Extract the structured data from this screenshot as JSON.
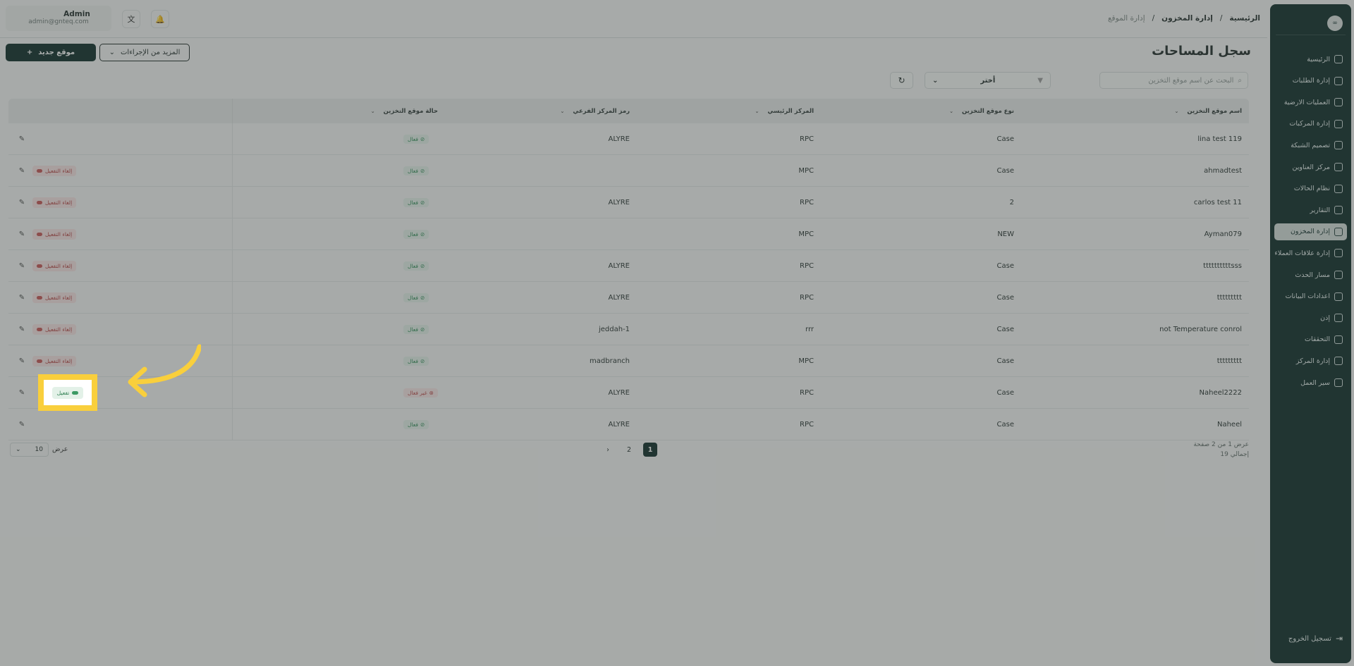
{
  "user": {
    "name": "Admin",
    "email": "admin@gnteq.com"
  },
  "breadcrumb": [
    "الرئيسية",
    "/",
    "إدارة المخزون",
    "/",
    "إدارة الموقع"
  ],
  "page_title": "سجل المساحات",
  "actions": {
    "new_location": "موقع جديد",
    "more_actions": "المزيد من الإجراءات"
  },
  "search": {
    "placeholder": "البحث عن اسم موقع التخزين"
  },
  "filter_select": {
    "value": "أختر"
  },
  "columns": [
    "اسم موقع التخزين",
    "نوع موقع التخزين",
    "المركز الرئيسي",
    "رمز المركز الفرعي",
    "حالة موقع التخزين"
  ],
  "rows": [
    {
      "name": "lina test 119",
      "type": "Case",
      "main": "RPC",
      "branch": "ALYRE",
      "status": "فعال"
    },
    {
      "name": "ahmadtest",
      "type": "Case",
      "main": "MPC",
      "branch": "",
      "status": "فعال"
    },
    {
      "name": "carlos test 11",
      "type": "2",
      "main": "RPC",
      "branch": "ALYRE",
      "status": "فعال"
    },
    {
      "name": "Ayman079",
      "type": "NEW",
      "main": "MPC",
      "branch": "",
      "status": "فعال"
    },
    {
      "name": "ttttttttttsss",
      "type": "Case",
      "main": "RPC",
      "branch": "ALYRE",
      "status": "فعال"
    },
    {
      "name": "ttttttttt",
      "type": "Case",
      "main": "RPC",
      "branch": "ALYRE",
      "status": "فعال"
    },
    {
      "name": "not Temperature conrol",
      "type": "Case",
      "main": "rrr",
      "branch": "jeddah-1",
      "status": "فعال"
    },
    {
      "name": "ttttttttt",
      "type": "Case",
      "main": "MPC",
      "branch": "madbranch",
      "status": "فعال"
    },
    {
      "name": "Naheel2222",
      "type": "Case",
      "main": "RPC",
      "branch": "ALYRE",
      "status": "غير فعال"
    },
    {
      "name": "Naheel",
      "type": "Case",
      "main": "RPC",
      "branch": "ALYRE",
      "status": "فعال"
    }
  ],
  "row_actions": {
    "deactivate": "إلغاء التفعيل",
    "activate": "تفعيل"
  },
  "pagination": {
    "page_size": "10",
    "page_size_label": "عرض",
    "pages": [
      "1",
      "2"
    ],
    "next": "›",
    "info_line1": "عرض 1 من 2 صفحة",
    "info_line2": "إجمالي 19"
  },
  "sidebar": {
    "logo": "∞",
    "items": [
      {
        "label": "الرئيسية"
      },
      {
        "label": "إدارة الطلبات"
      },
      {
        "label": "العمليات الارضية"
      },
      {
        "label": "إدارة المركبات"
      },
      {
        "label": "تصميم الشبكة"
      },
      {
        "label": "مركز العناوين"
      },
      {
        "label": "نظام الحالات"
      },
      {
        "label": "التقارير"
      },
      {
        "label": "إدارة المخزون"
      },
      {
        "label": "إدارة علاقات العملاء"
      },
      {
        "label": "مسار الحدث"
      },
      {
        "label": "اعدادات البيانات"
      },
      {
        "label": "إذن"
      },
      {
        "label": "التحققات"
      },
      {
        "label": "إدارة المركز"
      },
      {
        "label": "سير العمل"
      }
    ],
    "active_index": 8,
    "logout": "تسجيل الخروج"
  },
  "colors": {
    "sidebar_bg": "#0f2c29",
    "primary": "#0f2c29",
    "highlight": "#f9cf3c",
    "active_green": "#2e8a55",
    "inactive_red": "#b84646"
  }
}
